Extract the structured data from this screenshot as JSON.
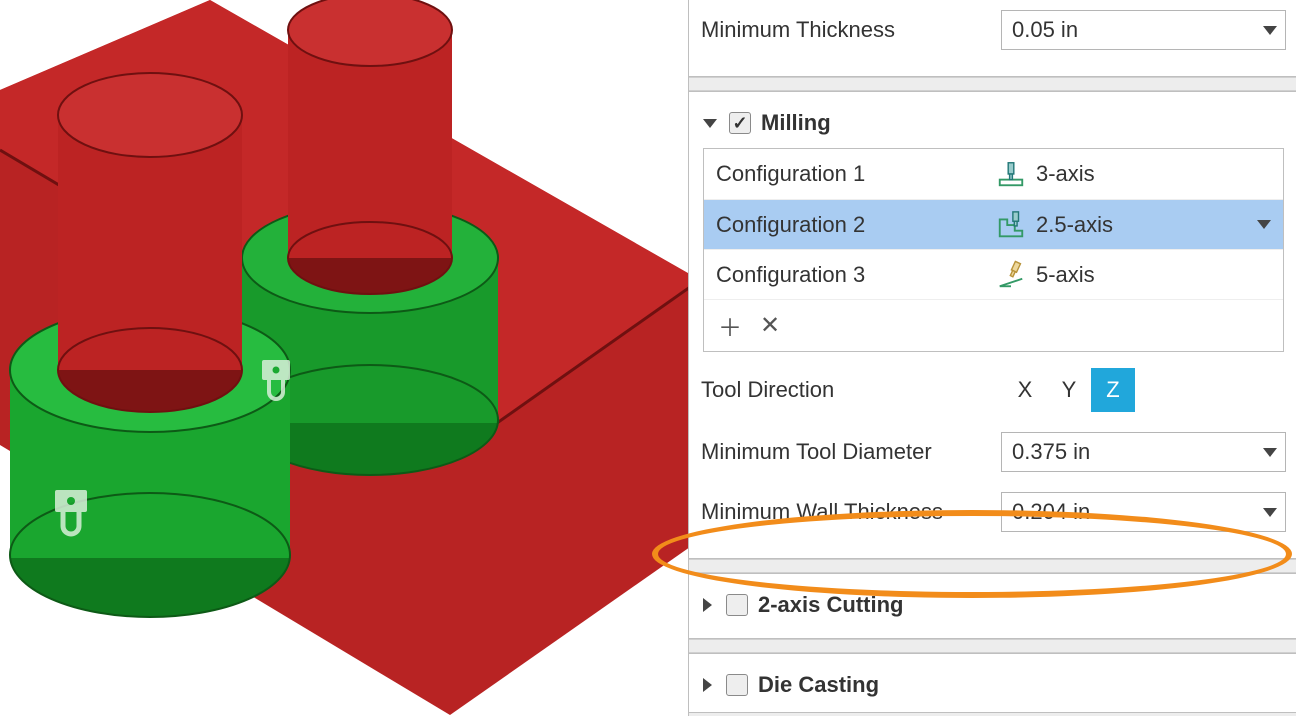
{
  "top_group": {
    "min_thickness_label": "Minimum Thickness",
    "min_thickness_value": "0.05 in"
  },
  "milling": {
    "title": "Milling",
    "checked": true,
    "configurations": [
      {
        "name": "Configuration 1",
        "type": "3-axis",
        "selected": false
      },
      {
        "name": "Configuration 2",
        "type": "2.5-axis",
        "selected": true
      },
      {
        "name": "Configuration 3",
        "type": "5-axis",
        "selected": false
      }
    ],
    "tool_direction_label": "Tool Direction",
    "tool_direction_options": [
      "X",
      "Y",
      "Z"
    ],
    "tool_direction_selected": "Z",
    "min_tool_diameter_label": "Minimum Tool Diameter",
    "min_tool_diameter_value": "0.375 in",
    "min_wall_thickness_label": "Minimum Wall Thickness",
    "min_wall_thickness_value": "0.204 in"
  },
  "sections": {
    "two_axis_cutting": {
      "title": "2-axis Cutting",
      "checked": false,
      "expanded": false
    },
    "die_casting": {
      "title": "Die Casting",
      "checked": false,
      "expanded": false
    }
  }
}
